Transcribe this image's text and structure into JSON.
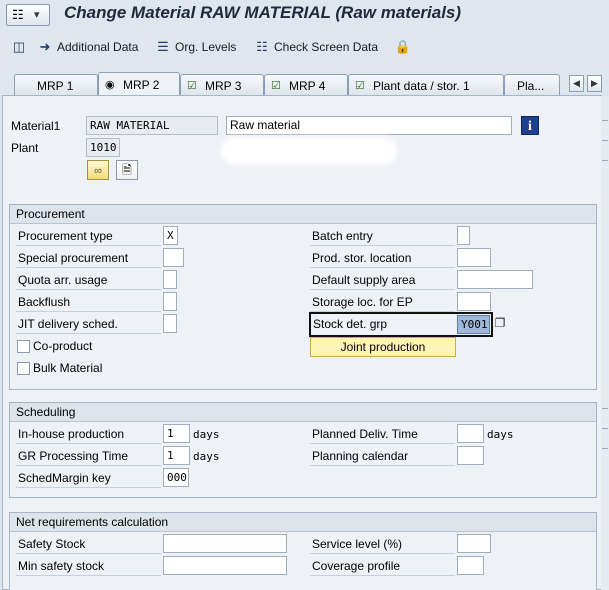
{
  "window": {
    "title": "Change Material RAW MATERIAL (Raw materials)"
  },
  "toolbar": {
    "items": [
      {
        "label": "Additional Data",
        "icon": "arrow-right-icon"
      },
      {
        "label": "Org. Levels",
        "icon": "org-levels-icon"
      },
      {
        "label": "Check Screen Data",
        "icon": "check-screen-icon"
      },
      {
        "label": "",
        "icon": "lock-icon"
      }
    ]
  },
  "tabs": [
    {
      "label": "MRP 1",
      "active": false
    },
    {
      "label": "MRP 2",
      "active": true
    },
    {
      "label": "MRP 3",
      "active": false
    },
    {
      "label": "MRP 4",
      "active": false
    },
    {
      "label": "Plant data / stor. 1",
      "active": false
    },
    {
      "label": "Pla...",
      "active": false
    }
  ],
  "header": {
    "material_label": "Material1",
    "material_value": "RAW MATERIAL",
    "material_desc": "Raw material",
    "plant_label": "Plant",
    "plant_value": "1010"
  },
  "procurement": {
    "title": "Procurement",
    "procurement_type_label": "Procurement type",
    "procurement_type_value": "X",
    "special_procurement_label": "Special procurement",
    "quota_label": "Quota arr. usage",
    "backflush_label": "Backflush",
    "jit_label": "JIT delivery sched.",
    "coproduct_label": "Co-product",
    "bulk_label": "Bulk Material",
    "batch_entry_label": "Batch entry",
    "prod_stor_label": "Prod. stor. location",
    "default_supply_label": "Default supply area",
    "storage_ep_label": "Storage loc. for EP",
    "stock_det_label": "Stock det. grp",
    "stock_det_value": "Y001",
    "joint_production_label": "Joint production"
  },
  "scheduling": {
    "title": "Scheduling",
    "inhouse_label": "In-house production",
    "inhouse_value": "1",
    "inhouse_unit": "days",
    "gr_label": "GR Processing Time",
    "gr_value": "1",
    "gr_unit": "days",
    "schedmargin_label": "SchedMargin key",
    "schedmargin_value": "000",
    "planned_deliv_label": "Planned Deliv. Time",
    "planned_deliv_unit": "days",
    "planning_cal_label": "Planning calendar"
  },
  "netreq": {
    "title": "Net requirements calculation",
    "safety_stock_label": "Safety Stock",
    "min_safety_label": "Min safety stock",
    "service_level_label": "Service level (%)",
    "coverage_label": "Coverage profile"
  }
}
